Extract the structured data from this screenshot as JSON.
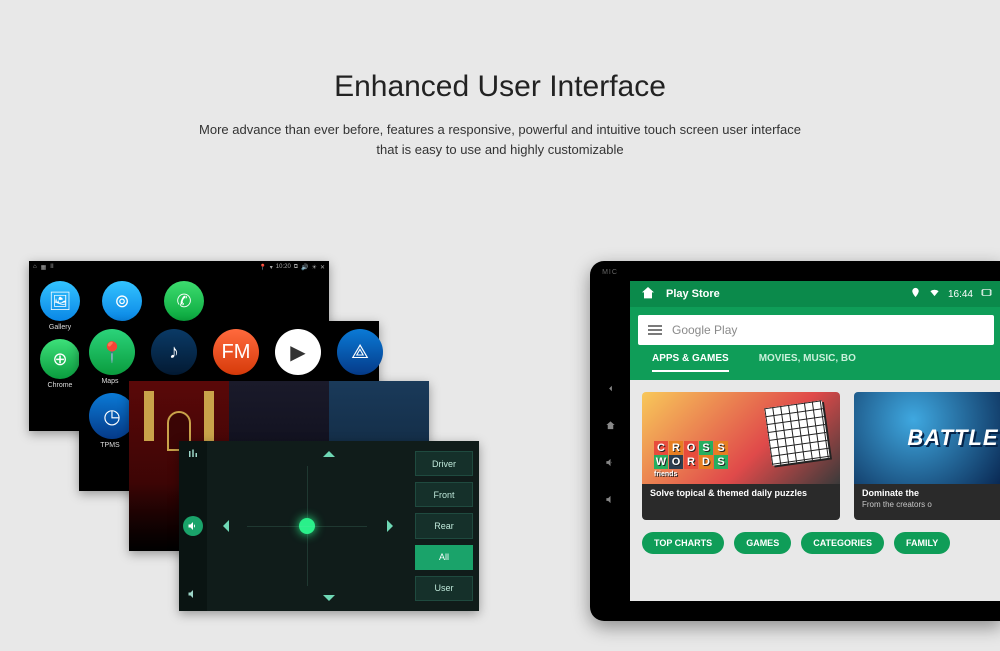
{
  "headline": {
    "title": "Enhanced User Interface",
    "sub1": "More advance than ever before, features a responsive, powerful and intuitive touch screen user interface",
    "sub2": "that is easy to use and highly customizable"
  },
  "screen1": {
    "time": "10:20",
    "apps": {
      "gallery": "Gallery",
      "chrome": "Chrome"
    }
  },
  "screen2": {
    "apps": {
      "maps": "Maps",
      "tpms": "TPMS"
    }
  },
  "fader": {
    "btn_driver": "Driver",
    "btn_front": "Front",
    "btn_rear": "Rear",
    "btn_all": "All",
    "btn_user": "User"
  },
  "tablet": {
    "mic": "MIC",
    "status_title": "Play Store",
    "status_time": "16:44",
    "search_placeholder": "Google Play",
    "tab_apps": "APPS & GAMES",
    "tab_movies": "MOVIES, MUSIC, BO",
    "card1_line1": "CROSS",
    "card1_line2": "WORDS",
    "card1_friends": "friends",
    "card1_cap": "Solve topical & themed daily puzzles",
    "card2_title": "BATTLE",
    "card2_cap1": "Dominate the",
    "card2_cap2": "From the creators o",
    "pill_top": "TOP CHARTS",
    "pill_games": "GAMES",
    "pill_cat": "CATEGORIES",
    "pill_family": "FAMILY"
  }
}
